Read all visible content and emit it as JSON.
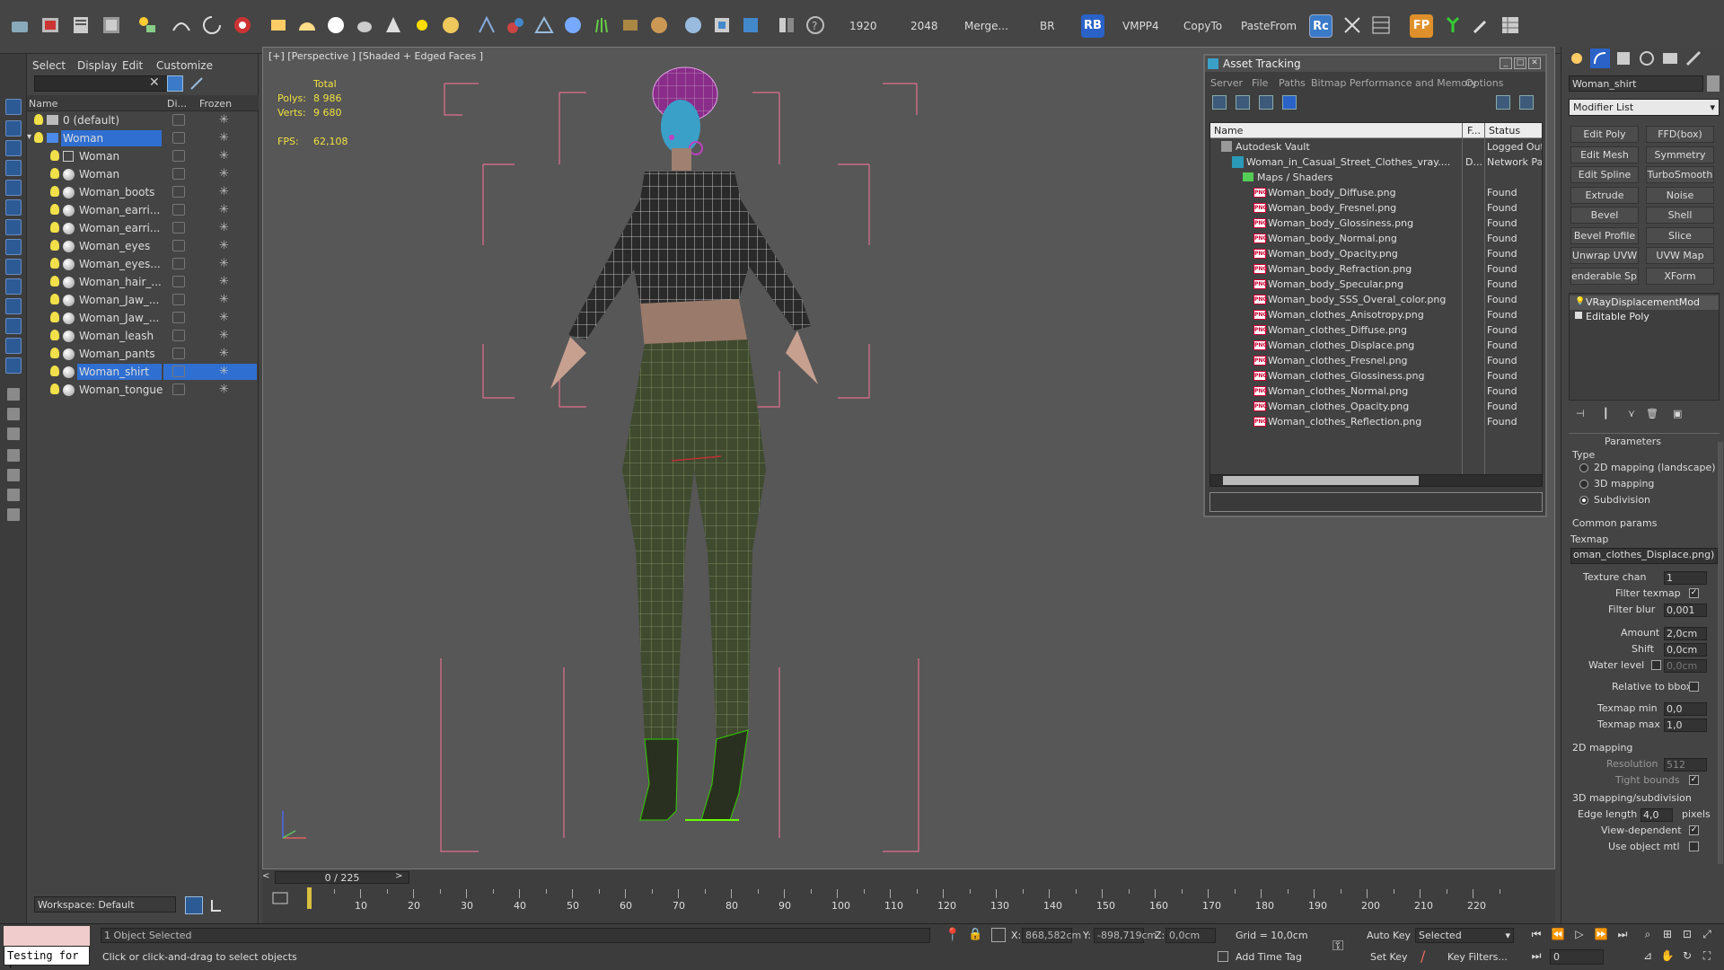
{
  "toolbar": {
    "width_value": "1920",
    "height_value": "2048",
    "merge_label": "Merge...",
    "br_label": "BR",
    "rb_label": "RB",
    "vmpp_label": "VMPP4",
    "copyto_label": "CopyTo",
    "pastefrom_label": "PasteFrom",
    "rc_label": "Rc",
    "fp_label": "FP"
  },
  "scene_explorer": {
    "menu": [
      "Select",
      "Display",
      "Edit",
      "Customize"
    ],
    "columns": [
      "Name",
      "Di...",
      "Frozen"
    ],
    "rows": [
      {
        "name": "0 (default)",
        "indent": 0,
        "type": "layer"
      },
      {
        "name": "Woman",
        "indent": 0,
        "type": "layer",
        "selected": true
      },
      {
        "name": "Woman",
        "indent": 1,
        "type": "bone"
      },
      {
        "name": "Woman",
        "indent": 1,
        "type": "mesh"
      },
      {
        "name": "Woman_boots",
        "indent": 1,
        "type": "mesh"
      },
      {
        "name": "Woman_earri...",
        "indent": 1,
        "type": "mesh"
      },
      {
        "name": "Woman_earri...",
        "indent": 1,
        "type": "mesh"
      },
      {
        "name": "Woman_eyes",
        "indent": 1,
        "type": "mesh"
      },
      {
        "name": "Woman_eyes...",
        "indent": 1,
        "type": "mesh"
      },
      {
        "name": "Woman_hair_...",
        "indent": 1,
        "type": "mesh"
      },
      {
        "name": "Woman_Jaw_...",
        "indent": 1,
        "type": "mesh"
      },
      {
        "name": "Woman_Jaw_...",
        "indent": 1,
        "type": "mesh"
      },
      {
        "name": "Woman_leash",
        "indent": 1,
        "type": "mesh"
      },
      {
        "name": "Woman_pants",
        "indent": 1,
        "type": "mesh"
      },
      {
        "name": "Woman_shirt",
        "indent": 1,
        "type": "mesh",
        "selected": true
      },
      {
        "name": "Woman_tongue",
        "indent": 1,
        "type": "mesh"
      }
    ],
    "workspace": "Workspace: Default"
  },
  "viewport": {
    "label": "[+] [Perspective ] [Shaded + Edged Faces ]",
    "stats_total": "Total",
    "polys_label": "Polys:",
    "polys_value": "8 986",
    "verts_label": "Verts:",
    "verts_value": "9 680",
    "fps_label": "FPS:",
    "fps_value": "62,108"
  },
  "asset_tracking": {
    "title": "Asset Tracking",
    "menu": [
      "Server",
      "File",
      "Paths",
      "Bitmap Performance and Memory",
      "Options"
    ],
    "columns": [
      "Name",
      "F...",
      "Status"
    ],
    "rows": [
      {
        "name": "Autodesk Vault",
        "f": "",
        "status": "Logged Out",
        "indent": 1,
        "icon": "vault"
      },
      {
        "name": "Woman_in_Casual_Street_Clothes_vray....",
        "f": "D...",
        "status": "Network Path",
        "indent": 2,
        "icon": "max"
      },
      {
        "name": "Maps / Shaders",
        "f": "",
        "status": "",
        "indent": 3,
        "icon": "folder"
      },
      {
        "name": "Woman_body_Diffuse.png",
        "f": "",
        "status": "Found",
        "indent": 4,
        "icon": "png"
      },
      {
        "name": "Woman_body_Fresnel.png",
        "f": "",
        "status": "Found",
        "indent": 4,
        "icon": "png"
      },
      {
        "name": "Woman_body_Glossiness.png",
        "f": "",
        "status": "Found",
        "indent": 4,
        "icon": "png"
      },
      {
        "name": "Woman_body_Normal.png",
        "f": "",
        "status": "Found",
        "indent": 4,
        "icon": "png"
      },
      {
        "name": "Woman_body_Opacity.png",
        "f": "",
        "status": "Found",
        "indent": 4,
        "icon": "png"
      },
      {
        "name": "Woman_body_Refraction.png",
        "f": "",
        "status": "Found",
        "indent": 4,
        "icon": "png"
      },
      {
        "name": "Woman_body_Specular.png",
        "f": "",
        "status": "Found",
        "indent": 4,
        "icon": "png"
      },
      {
        "name": "Woman_body_SSS_Overal_color.png",
        "f": "",
        "status": "Found",
        "indent": 4,
        "icon": "png"
      },
      {
        "name": "Woman_clothes_Anisotropy.png",
        "f": "",
        "status": "Found",
        "indent": 4,
        "icon": "png"
      },
      {
        "name": "Woman_clothes_Diffuse.png",
        "f": "",
        "status": "Found",
        "indent": 4,
        "icon": "png"
      },
      {
        "name": "Woman_clothes_Displace.png",
        "f": "",
        "status": "Found",
        "indent": 4,
        "icon": "png"
      },
      {
        "name": "Woman_clothes_Fresnel.png",
        "f": "",
        "status": "Found",
        "indent": 4,
        "icon": "png"
      },
      {
        "name": "Woman_clothes_Glossiness.png",
        "f": "",
        "status": "Found",
        "indent": 4,
        "icon": "png"
      },
      {
        "name": "Woman_clothes_Normal.png",
        "f": "",
        "status": "Found",
        "indent": 4,
        "icon": "png"
      },
      {
        "name": "Woman_clothes_Opacity.png",
        "f": "",
        "status": "Found",
        "indent": 4,
        "icon": "png"
      },
      {
        "name": "Woman_clothes_Reflection.png",
        "f": "",
        "status": "Found",
        "indent": 4,
        "icon": "png"
      }
    ]
  },
  "command_panel": {
    "object_name": "Woman_shirt",
    "modifier_list": "Modifier List",
    "buttons": [
      "Edit Poly",
      "FFD(box)",
      "Edit Mesh",
      "Symmetry",
      "Edit Spline",
      "TurboSmooth",
      "Extrude",
      "Noise",
      "Bevel",
      "Shell",
      "Bevel Profile",
      "Slice",
      "Unwrap UVW",
      "UVW Map",
      "enderable Splir",
      "XForm"
    ],
    "stack": [
      "VRayDisplacementMod",
      "Editable Poly"
    ],
    "parameters_title": "Parameters",
    "type_label": "Type",
    "radio_2d": "2D mapping (landscape)",
    "radio_3d": "3D mapping",
    "radio_sub": "Subdivision",
    "common_params": "Common params",
    "texmap_label": "Texmap",
    "texmap_value": "oman_clothes_Displace.png)",
    "texture_chan_label": "Texture chan",
    "texture_chan_value": "1",
    "filter_texmap_label": "Filter texmap",
    "filter_blur_label": "Filter blur",
    "filter_blur_value": "0,001",
    "amount_label": "Amount",
    "amount_value": "2,0cm",
    "shift_label": "Shift",
    "shift_value": "0,0cm",
    "water_level_label": "Water level",
    "water_level_value": "0,0cm",
    "relative_bbox_label": "Relative to bbox",
    "texmap_min_label": "Texmap min",
    "texmap_min_value": "0,0",
    "texmap_max_label": "Texmap max",
    "texmap_max_value": "1,0",
    "mapping2d_label": "2D mapping",
    "resolution_label": "Resolution",
    "resolution_value": "512",
    "tight_bounds_label": "Tight bounds",
    "mapping3d_label": "3D mapping/subdivision",
    "edge_length_label": "Edge length",
    "edge_length_value": "4,0",
    "pixels_label": "pixels",
    "view_dependent_label": "View-dependent",
    "use_object_mtl_label": "Use object mtl"
  },
  "timeline": {
    "slider_text": "0 / 225",
    "ticks": [
      "10",
      "20",
      "30",
      "40",
      "50",
      "60",
      "70",
      "80",
      "90",
      "100",
      "110",
      "120",
      "130",
      "140",
      "150",
      "160",
      "170",
      "180",
      "190",
      "200",
      "210",
      "220"
    ]
  },
  "status": {
    "maxscript": "Testing for :",
    "selection": "1 Object Selected",
    "prompt": "Click or click-and-drag to select objects",
    "x_label": "X:",
    "x_value": "868,582cm",
    "y_label": "Y:",
    "y_value": "-898,719cm",
    "z_label": "Z:",
    "z_value": "0,0cm",
    "grid": "Grid = 10,0cm",
    "add_time_tag": "Add Time Tag",
    "auto_key": "Auto Key",
    "selected": "Selected",
    "set_key": "Set Key",
    "key_filters": "Key Filters...",
    "frame_value": "0"
  }
}
